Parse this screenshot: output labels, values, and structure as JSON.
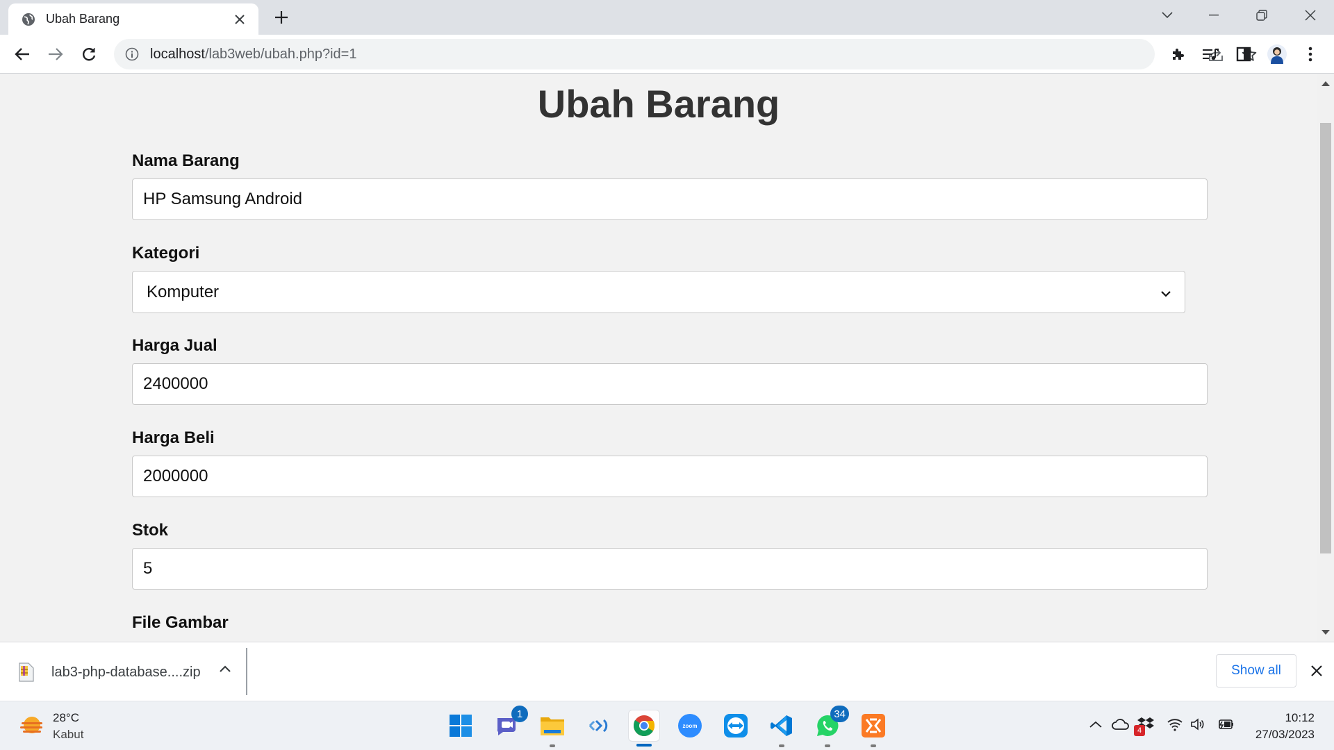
{
  "browser": {
    "tab_title": "Ubah Barang",
    "url_host": "localhost",
    "url_path": "/lab3web/ubah.php?id=1"
  },
  "page": {
    "title": "Ubah Barang",
    "fields": [
      {
        "label": "Nama Barang",
        "value": "HP Samsung Android"
      },
      {
        "label": "Kategori",
        "value": "Komputer"
      },
      {
        "label": "Harga Jual",
        "value": "2400000"
      },
      {
        "label": "Harga Beli",
        "value": "2000000"
      },
      {
        "label": "Stok",
        "value": "5"
      },
      {
        "label": "File Gambar"
      }
    ]
  },
  "download_bar": {
    "file_name": "lab3-php-database....zip",
    "show_all_label": "Show all"
  },
  "taskbar": {
    "weather_temp": "28°C",
    "weather_desc": "Kabut",
    "teams_badge": "1",
    "whatsapp_badge": "34",
    "tray_badge": "4",
    "time": "10:12",
    "date": "27/03/2023"
  },
  "colors": {
    "accent": "#1a73e8",
    "taskbar_active": "#0067c0",
    "page_bg": "#f2f2f2"
  }
}
